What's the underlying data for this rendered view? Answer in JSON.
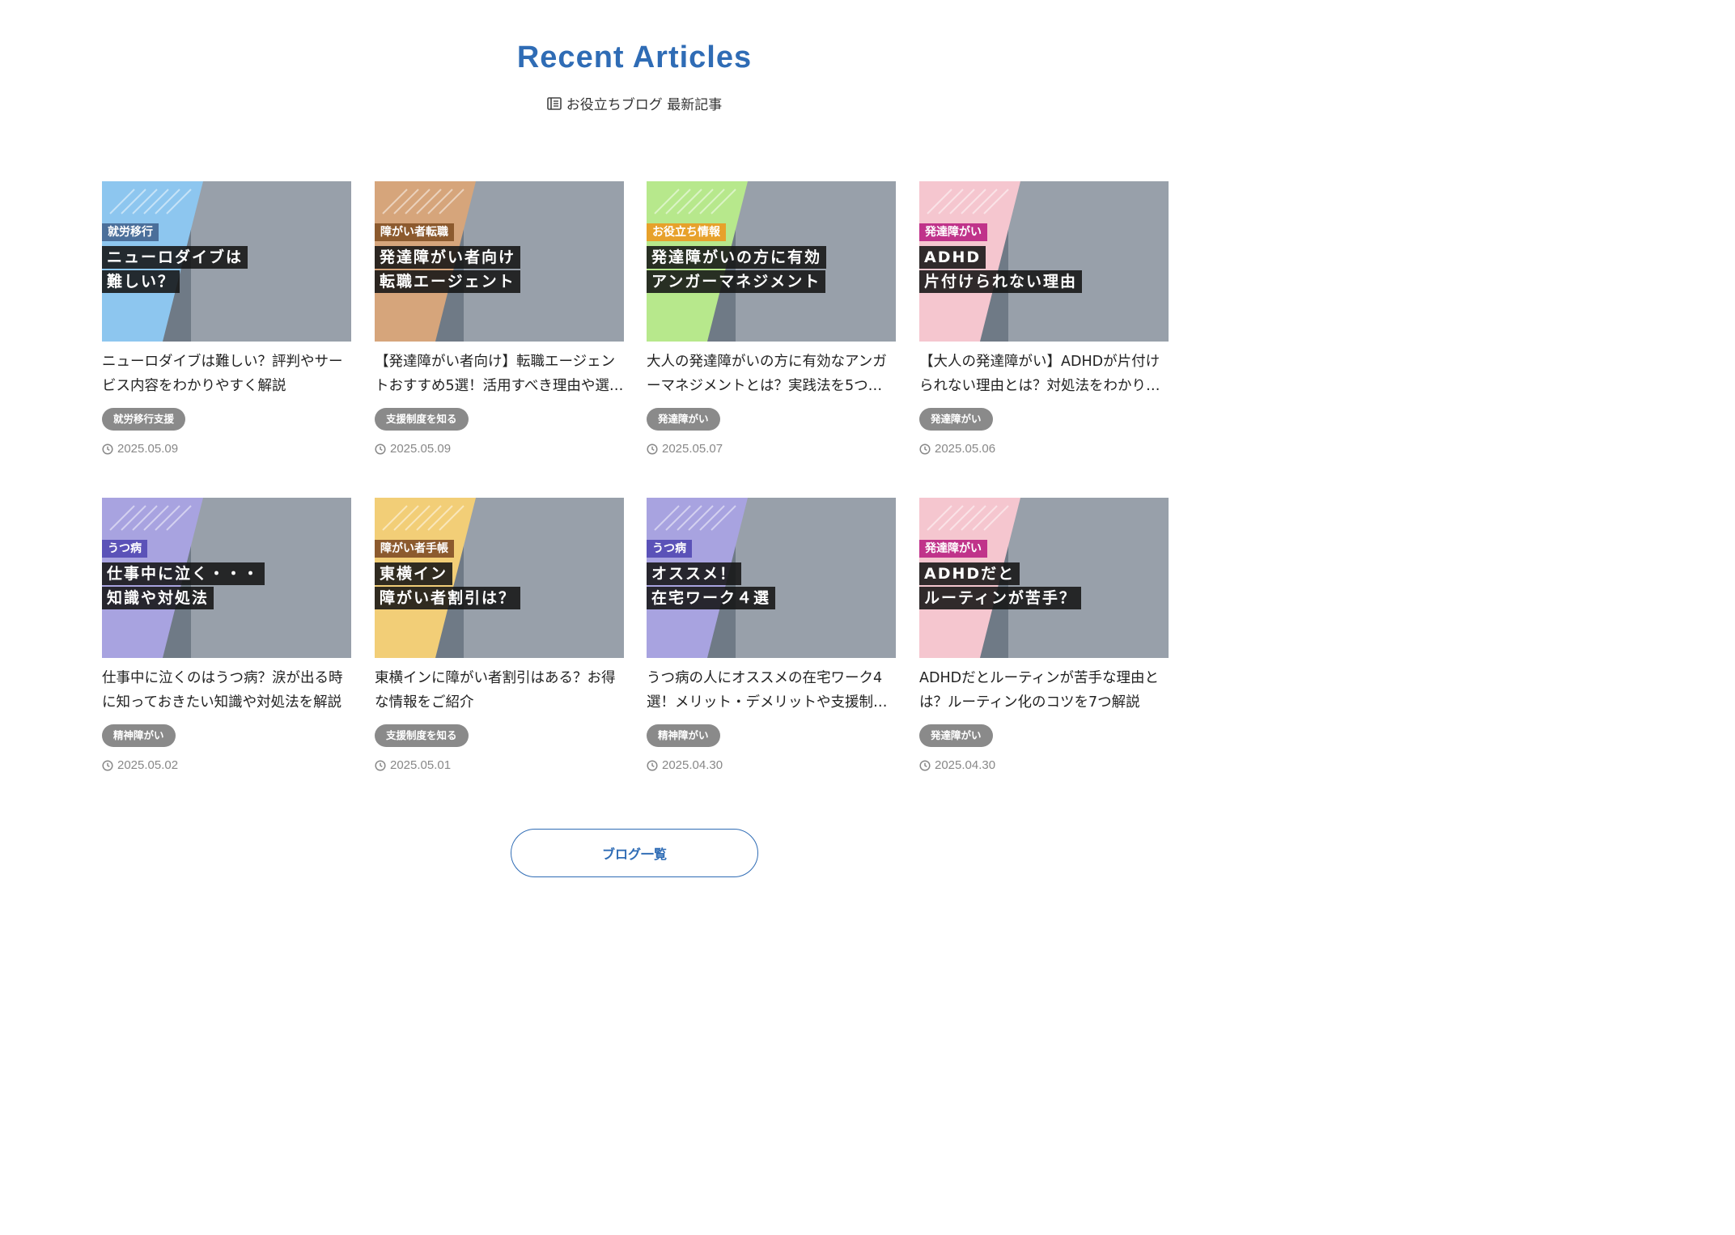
{
  "header": {
    "title": "Recent Articles",
    "subtitle": "お役立ちブログ 最新記事",
    "subtitle_icon": "book-icon"
  },
  "articles": [
    {
      "thumb_category": "就労移行",
      "thumb_lines": [
        "ニューロダイブは",
        "難しい？"
      ],
      "title": "ニューロダイブは難しい？評判やサービス内容をわかりやすく解説",
      "tag": "就労移行支援",
      "date": "2025.05.09",
      "accent": "#8dc6ef",
      "cat_color": "#4b6f9a"
    },
    {
      "thumb_category": "障がい者転職",
      "thumb_lines": [
        "発達障がい者向け",
        "転職エージェント"
      ],
      "title": "【発達障がい者向け】転職エージェントおすすめ5選！活用すべき理由や選…",
      "tag": "支援制度を知る",
      "date": "2025.05.09",
      "accent": "#d6a57b",
      "cat_color": "#8c5a2e"
    },
    {
      "thumb_category": "お役立ち情報",
      "thumb_lines": [
        "発達障がいの方に有効",
        "アンガーマネジメント"
      ],
      "title": "大人の発達障がいの方に有効なアンガーマネジメントとは？実践法を5つ…",
      "tag": "発達障がい",
      "date": "2025.05.07",
      "accent": "#b7e88c",
      "cat_color": "#e7a12b"
    },
    {
      "thumb_category": "発達障がい",
      "thumb_lines": [
        "ADHD",
        "片付けられない理由"
      ],
      "title": "【大人の発達障がい】ADHDが片付けられない理由とは？対処法をわかり…",
      "tag": "発達障がい",
      "date": "2025.05.06",
      "accent": "#f5c6cf",
      "cat_color": "#c0338a"
    },
    {
      "thumb_category": "うつ病",
      "thumb_lines": [
        "仕事中に泣く・・・",
        "知識や対処法"
      ],
      "title": "仕事中に泣くのはうつ病？涙が出る時に知っておきたい知識や対処法を解説",
      "tag": "精神障がい",
      "date": "2025.05.02",
      "accent": "#a8a3e0",
      "cat_color": "#5b52b8"
    },
    {
      "thumb_category": "障がい者手帳",
      "thumb_lines": [
        "東横イン",
        "障がい者割引は？"
      ],
      "title": "東横インに障がい者割引はある？お得な情報をご紹介",
      "tag": "支援制度を知る",
      "date": "2025.05.01",
      "accent": "#f2ce77",
      "cat_color": "#8c5a2e"
    },
    {
      "thumb_category": "うつ病",
      "thumb_lines": [
        "オススメ！",
        "在宅ワーク４選"
      ],
      "title": "うつ病の人にオススメの在宅ワーク4選！メリット・デメリットや支援制…",
      "tag": "精神障がい",
      "date": "2025.04.30",
      "accent": "#a8a3e0",
      "cat_color": "#5b52b8"
    },
    {
      "thumb_category": "発達障がい",
      "thumb_lines": [
        "ADHDだと",
        "ルーティンが苦手？"
      ],
      "title": "ADHDだとルーティンが苦手な理由とは？ルーティン化のコツを7つ解説",
      "tag": "発達障がい",
      "date": "2025.04.30",
      "accent": "#f5c6cf",
      "cat_color": "#c0338a"
    }
  ],
  "more_button": {
    "label": "ブログ一覧"
  }
}
